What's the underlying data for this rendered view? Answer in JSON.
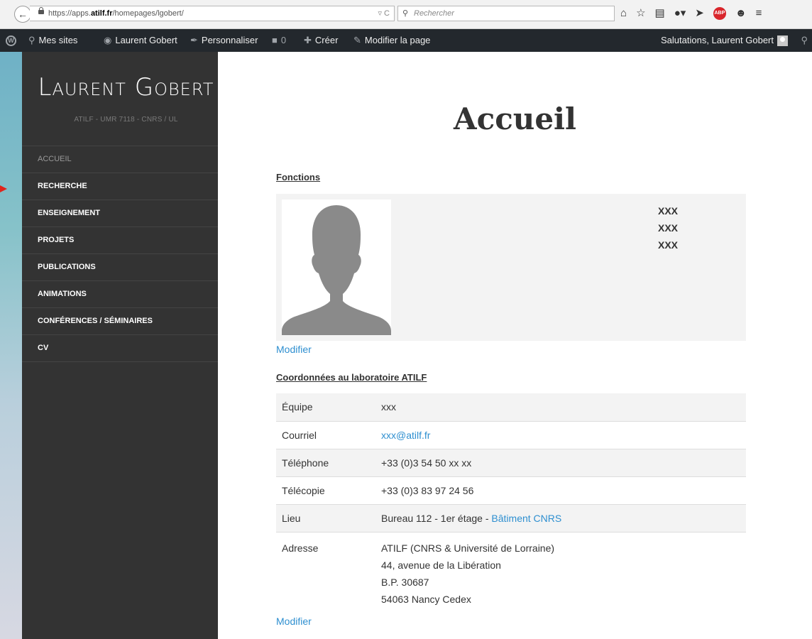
{
  "browser": {
    "url_prefix": "https://apps.",
    "url_domain": "atilf.fr",
    "url_suffix": "/homepages/lgobert/",
    "url_actions": "▿ C",
    "search_placeholder": "Rechercher",
    "icons": [
      "home-icon",
      "bookmark-star-icon",
      "reading-list-icon",
      "addon-icon",
      "send-icon",
      "adblock-plus-icon",
      "chat-icon",
      "menu-icon"
    ],
    "abp_label": "ABP"
  },
  "adminbar": {
    "my_sites": "Mes sites",
    "site_name": "Laurent Gobert",
    "customize": "Personnaliser",
    "comments_count": "0",
    "new": "Créer",
    "edit_page": "Modifier la page",
    "greeting": "Salutations, Laurent Gobert"
  },
  "sidebar": {
    "title": "Laurent Gobert",
    "description": "ATILF - UMR 7118 - CNRS / UL",
    "menu": [
      {
        "label": "Accueil",
        "active": true
      },
      {
        "label": "Recherche"
      },
      {
        "label": "Enseignement"
      },
      {
        "label": "Projets"
      },
      {
        "label": "Publications"
      },
      {
        "label": "Animations"
      },
      {
        "label": "Conférences / Séminaires"
      },
      {
        "label": "CV"
      }
    ]
  },
  "main": {
    "heading": "Accueil",
    "functions_title": "Fonctions",
    "functions": [
      "XXX",
      "XXX",
      "XXX"
    ],
    "edit_label": "Modifier",
    "lab_title": "Coordonnées au laboratoire ATILF",
    "rows": [
      {
        "key": "Équipe",
        "value": "xxx"
      },
      {
        "key": "Courriel",
        "value": "xxx@atilf.fr"
      },
      {
        "key": "Téléphone",
        "value": "+33 (0)3 54 50 xx xx"
      },
      {
        "key": "Télécopie",
        "value": "+33 (0)3 83 97 24 56"
      },
      {
        "key": "Lieu",
        "value": "Bureau 112 - 1er étage - ",
        "link": "Bâtiment CNRS"
      },
      {
        "key": "Adresse",
        "lines": [
          "ATILF (CNRS & Université de Lorraine)",
          "44, avenue de la Libération",
          "B.P. 30687",
          "54063 Nancy Cedex"
        ]
      }
    ]
  },
  "colors": {
    "link": "#2e8fd0",
    "sidebar": "#333333",
    "adminbar": "#23282d"
  }
}
